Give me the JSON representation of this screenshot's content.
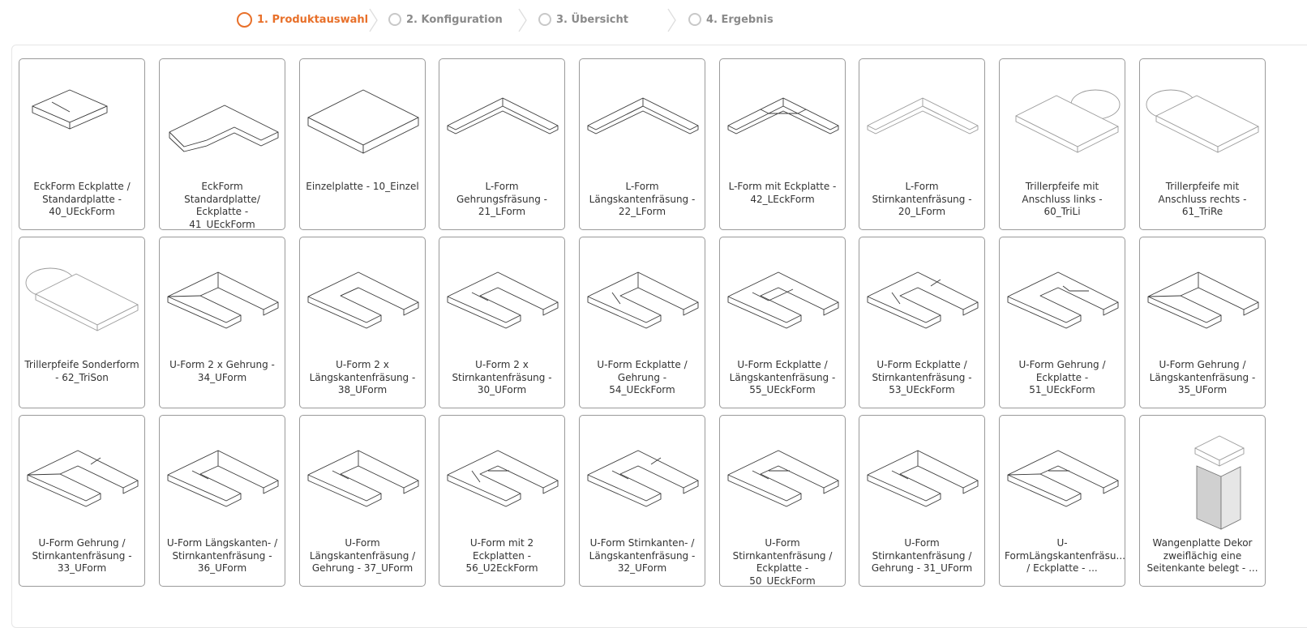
{
  "steps": [
    {
      "label": "1. Produktauswahl",
      "active": true
    },
    {
      "label": "2. Konfiguration",
      "active": false
    },
    {
      "label": "3. Übersicht",
      "active": false
    },
    {
      "label": "4. Ergebnis",
      "active": false
    }
  ],
  "colors": {
    "accent": "#e8702a",
    "inactive": "#c8c8c8"
  },
  "products": [
    {
      "label": "EckForm Eckplatte / Standardplatte - 40_UEckForm",
      "icon": "eckform-eckplatte-icon"
    },
    {
      "label": "EckForm Standardplatte/ Eckplatte - 41_UEckForm",
      "icon": "eckform-standardplatte-icon"
    },
    {
      "label": "Einzelplatte - 10_Einzel",
      "icon": "einzelplatte-icon"
    },
    {
      "label": "L-Form Gehrungsfräsung - 21_LForm",
      "icon": "l-form-gehrung-icon"
    },
    {
      "label": "L-Form Längskantenfräsung - 22_LForm",
      "icon": "l-form-laengskante-icon"
    },
    {
      "label": "L-Form mit Eckplatte - 42_LEckForm",
      "icon": "l-form-eckplatte-icon"
    },
    {
      "label": "L-Form Stirnkantenfräsung - 20_LForm",
      "icon": "l-form-stirnkante-icon"
    },
    {
      "label": "Trillerpfeife mit Anschluss links - 60_TriLi",
      "icon": "trillerpfeife-links-icon"
    },
    {
      "label": "Trillerpfeife mit Anschluss rechts - 61_TriRe",
      "icon": "trillerpfeife-rechts-icon"
    },
    {
      "label": "Trillerpfeife Sonderform - 62_TriSon",
      "icon": "trillerpfeife-sonderform-icon"
    },
    {
      "label": "U-Form 2 x Gehrung - 34_UForm",
      "icon": "u-form-gehrung-icon"
    },
    {
      "label": "U-Form 2 x Längskantenfräsung - 38_UForm",
      "icon": "u-form-laengskante-icon"
    },
    {
      "label": "U-Form 2 x Stirnkantenfräsung - 30_UForm",
      "icon": "u-form-stirnkante-icon"
    },
    {
      "label": "U-Form Eckplatte / Gehrung - 54_UEckForm",
      "icon": "u-form-eckplatte-gehrung-icon"
    },
    {
      "label": "U-Form Eckplatte / Längskantenfräsung - 55_UEckForm",
      "icon": "u-form-eckplatte-laengskante-icon"
    },
    {
      "label": "U-Form Eckplatte / Stirnkantenfräsung - 53_UEckForm",
      "icon": "u-form-eckplatte-stirnkante-icon"
    },
    {
      "label": "U-Form Gehrung / Eckplatte - 51_UEckForm",
      "icon": "u-form-gehrung-eckplatte-icon"
    },
    {
      "label": "U-Form Gehrung / Längskantenfräsung - 35_UForm",
      "icon": "u-form-gehrung-laengskante-icon"
    },
    {
      "label": "U-Form Gehrung / Stirnkantenfräsung - 33_UForm",
      "icon": "u-form-gehrung-stirnkante-icon"
    },
    {
      "label": "U-Form Längskanten- / Stirnkantenfräsung - 36_UForm",
      "icon": "u-form-laengs-stirnkante-icon"
    },
    {
      "label": "U-Form Längskantenfräsung / Gehrung - 37_UForm",
      "icon": "u-form-laengskante-gehrung-icon"
    },
    {
      "label": "U-Form mit 2 Eckplatten - 56_U2EckForm",
      "icon": "u-form-2-eckplatten-icon"
    },
    {
      "label": "U-Form Stirnkanten- / Längskantenfräsung - 32_UForm",
      "icon": "u-form-stirn-laengskante-icon"
    },
    {
      "label": "U-Form Stirnkantenfräsung / Eckplatte - 50_UEckForm",
      "icon": "u-form-stirnkante-eckplatte-icon"
    },
    {
      "label": "U-Form Stirnkantenfräsung / Gehrung - 31_UForm",
      "icon": "u-form-stirnkante-gehrung-icon"
    },
    {
      "label": "U-FormLängskantenfräsu... / Eckplatte - ...",
      "icon": "u-form-laengskante-eckplatte-icon"
    },
    {
      "label": "Wangenplatte Dekor zweiflächig eine Seitenkante belegt - ...",
      "icon": "wangenplatte-icon"
    }
  ]
}
